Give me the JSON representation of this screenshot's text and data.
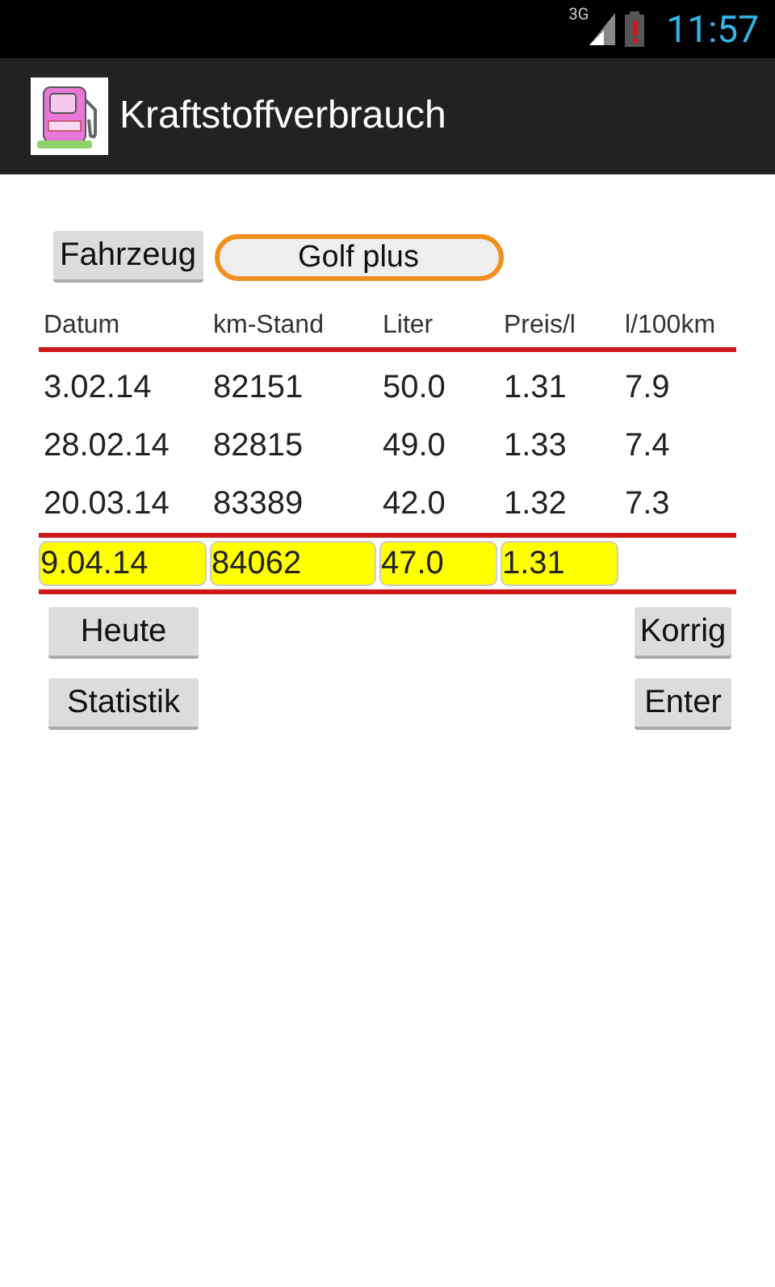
{
  "status_bar": {
    "network": "3G",
    "time": "11:57"
  },
  "action_bar": {
    "title": "Kraftstoffverbrauch"
  },
  "vehicle": {
    "button": "Fahrzeug",
    "selection": "Golf plus"
  },
  "table": {
    "columns": [
      "Datum",
      "km-Stand",
      "Liter",
      "Preis/l",
      "l/100km"
    ],
    "rows": [
      [
        "3.02.14",
        "82151",
        "50.0",
        "1.31",
        "7.9"
      ],
      [
        "28.02.14",
        "82815",
        "49.0",
        "1.33",
        "7.4"
      ],
      [
        "20.03.14",
        "83389",
        "42.0",
        "1.32",
        "7.3"
      ]
    ],
    "inputs": [
      "9.04.14",
      "84062",
      "47.0",
      "1.31"
    ]
  },
  "buttons": [
    [
      "Heute",
      "Korrig"
    ],
    [
      "Statistik",
      "Enter"
    ]
  ]
}
